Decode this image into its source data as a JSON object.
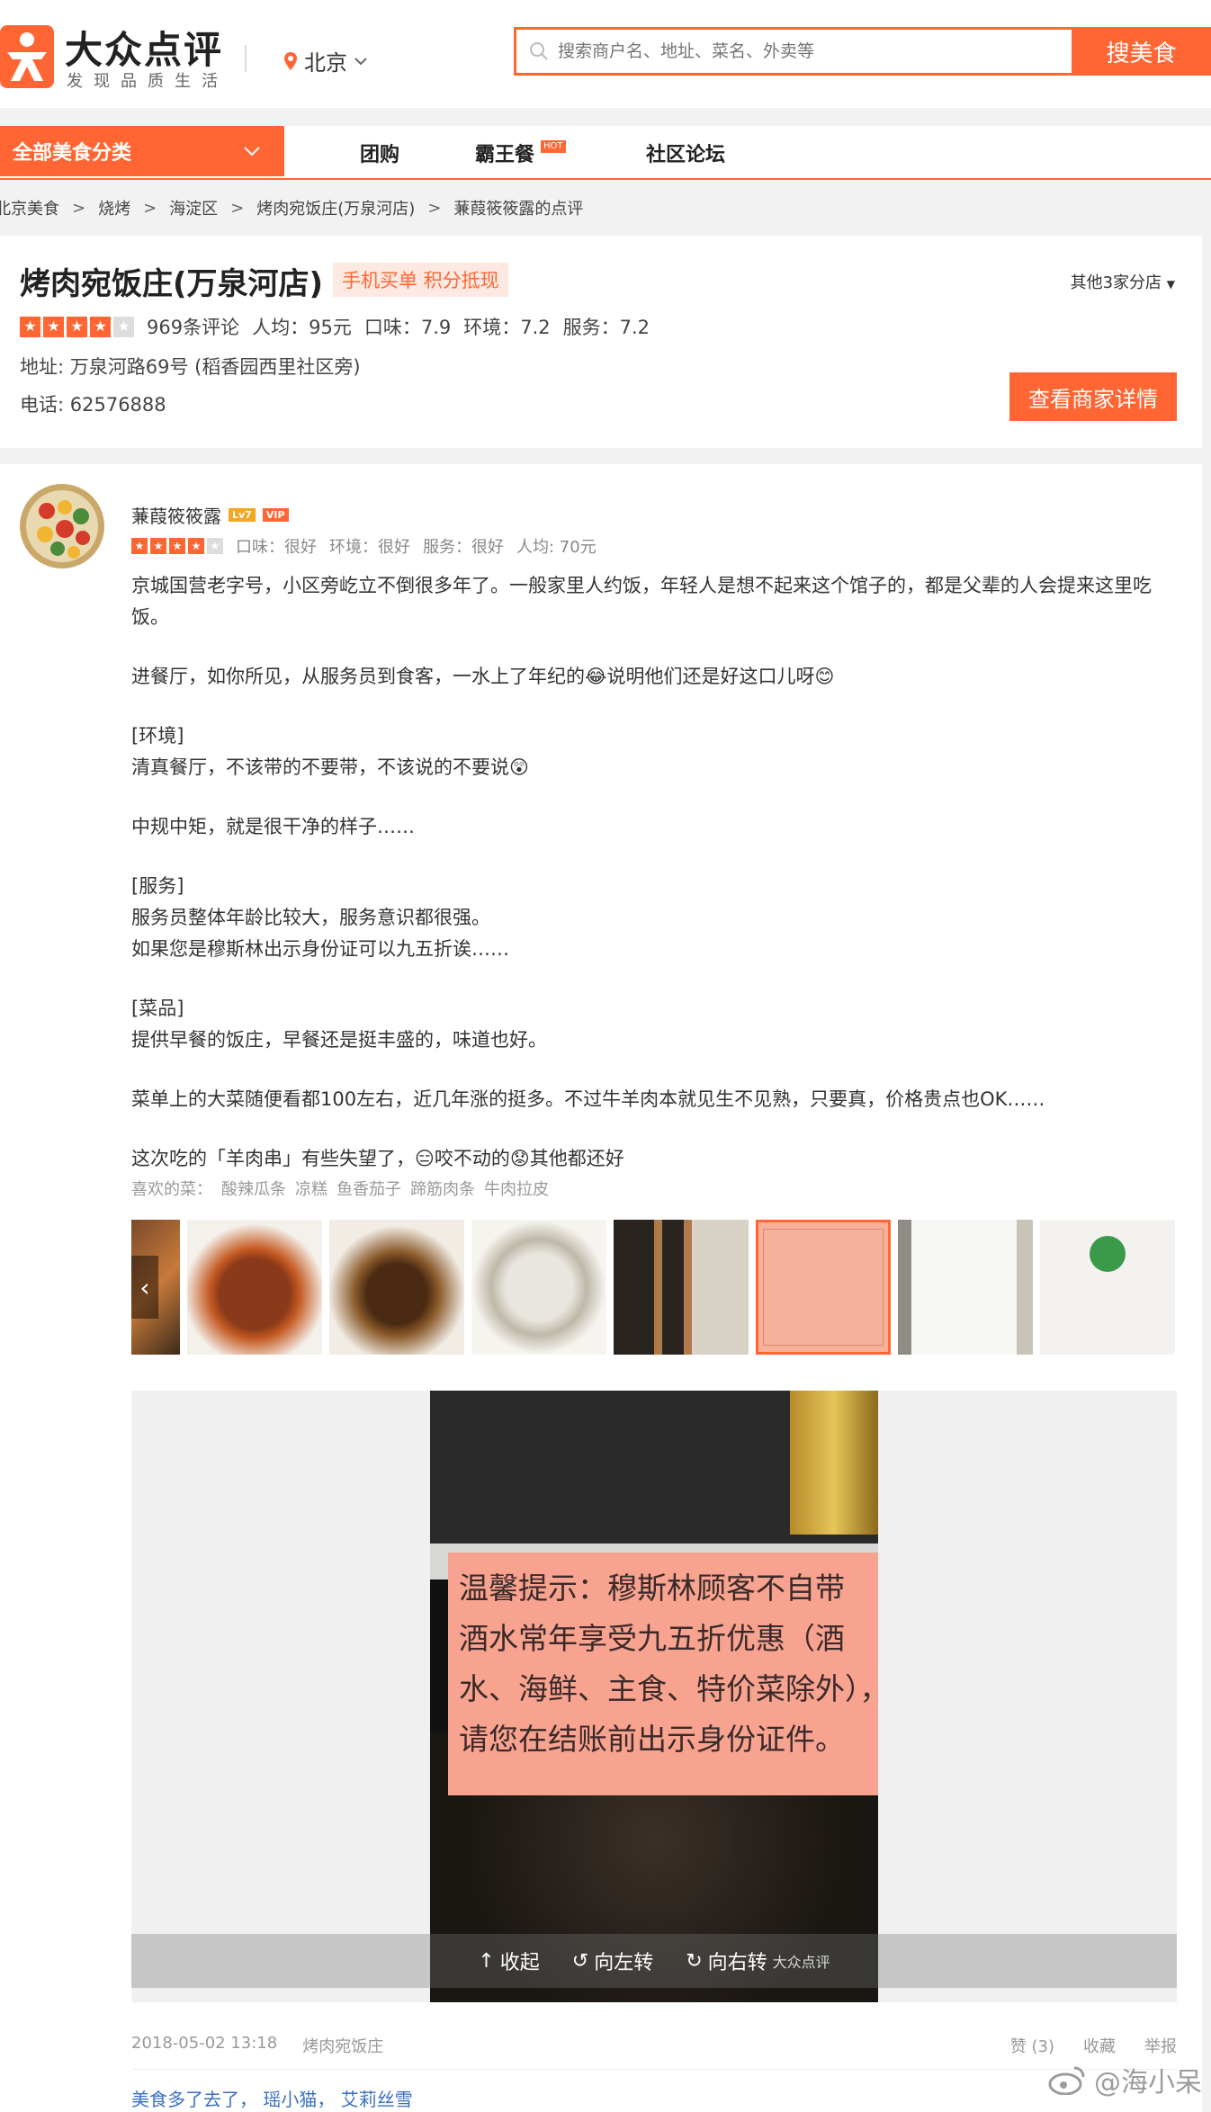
{
  "header": {
    "logo_text": "大众点评",
    "slogan": "发现品质生活",
    "city": "北京",
    "search_placeholder": "搜索商户名、地址、菜名、外卖等",
    "search_button": "搜美食"
  },
  "nav": {
    "category": "全部美食分类",
    "items": [
      "团购",
      "霸王餐",
      "社区论坛"
    ],
    "hot_badge": "HOT"
  },
  "breadcrumb": [
    "北京美食",
    "烧烤",
    "海淀区",
    "烤肉宛饭庄(万泉河店)",
    "蒹葭筱筱露的点评"
  ],
  "shop": {
    "name": "烤肉宛饭庄(万泉河店)",
    "tag": "手机买单 积分抵现",
    "branches": "其他3家分店",
    "rating": 4,
    "reviews": "969条评论",
    "avg": "人均：95元",
    "taste": "口味：7.9",
    "env": "环境：7.2",
    "service": "服务：7.2",
    "address": "地址: 万泉河路69号 (稻香园西里社区旁)",
    "phone": "电话: 62576888",
    "detail_button": "查看商家详情"
  },
  "review": {
    "user": "蒹葭筱筱露",
    "level": "Lv7",
    "vip": "VIP",
    "rating": 4,
    "taste": "口味：很好",
    "env": "环境：很好",
    "service": "服务：很好",
    "avg": "人均: 70元",
    "paragraphs": [
      "京城国营老字号，小区旁屹立不倒很多年了。一般家里人约饭，年轻人是想不起来这个馆子的，都是父辈的人会提来这里吃饭。",
      "进餐厅，如你所见，从服务员到食客，一水上了年纪的😂说明他们还是好这口儿呀😊",
      "[环境]\n清真餐厅，不该带的不要带，不该说的不要说😲",
      "中规中矩，就是很干净的样子……",
      "[服务]\n服务员整体年龄比较大，服务意识都很强。\n如果您是穆斯林出示身份证可以九五折诶……",
      "[菜品]\n提供早餐的饭庄，早餐还是挺丰盛的，味道也好。",
      "菜单上的大菜随便看都100左右，近几年涨的挺多。不过牛羊肉本就见生不见熟，只要真，价格贵点也OK……",
      "这次吃的「羊肉串」有些失望了，😑咬不动的😟其他都还好"
    ],
    "liked_label": "喜欢的菜：",
    "liked_dishes": [
      "酸辣瓜条",
      "凉糕",
      "鱼香茄子",
      "蹄筋肉条",
      "牛肉拉皮"
    ],
    "sign_text": [
      "温馨提示：穆斯林顾客不自带",
      "酒水常年享受九五折优惠（酒",
      "水、海鲜、主食、特价菜除外），",
      "请您在结账前出示身份证件。"
    ],
    "viewer_actions": [
      "收起",
      "向左转",
      "向右转"
    ],
    "watermark": "大众点评",
    "date": "2018-05-02 13:18",
    "shop_short": "烤肉宛饭庄",
    "like": "赞 (3)",
    "fav": "收藏",
    "report": "举报",
    "commenters": "美食多了去了， 瑶小猫， 艾莉丝雪"
  },
  "weibo": "@海小呆",
  "colors": {
    "accent": "#ff6633"
  }
}
